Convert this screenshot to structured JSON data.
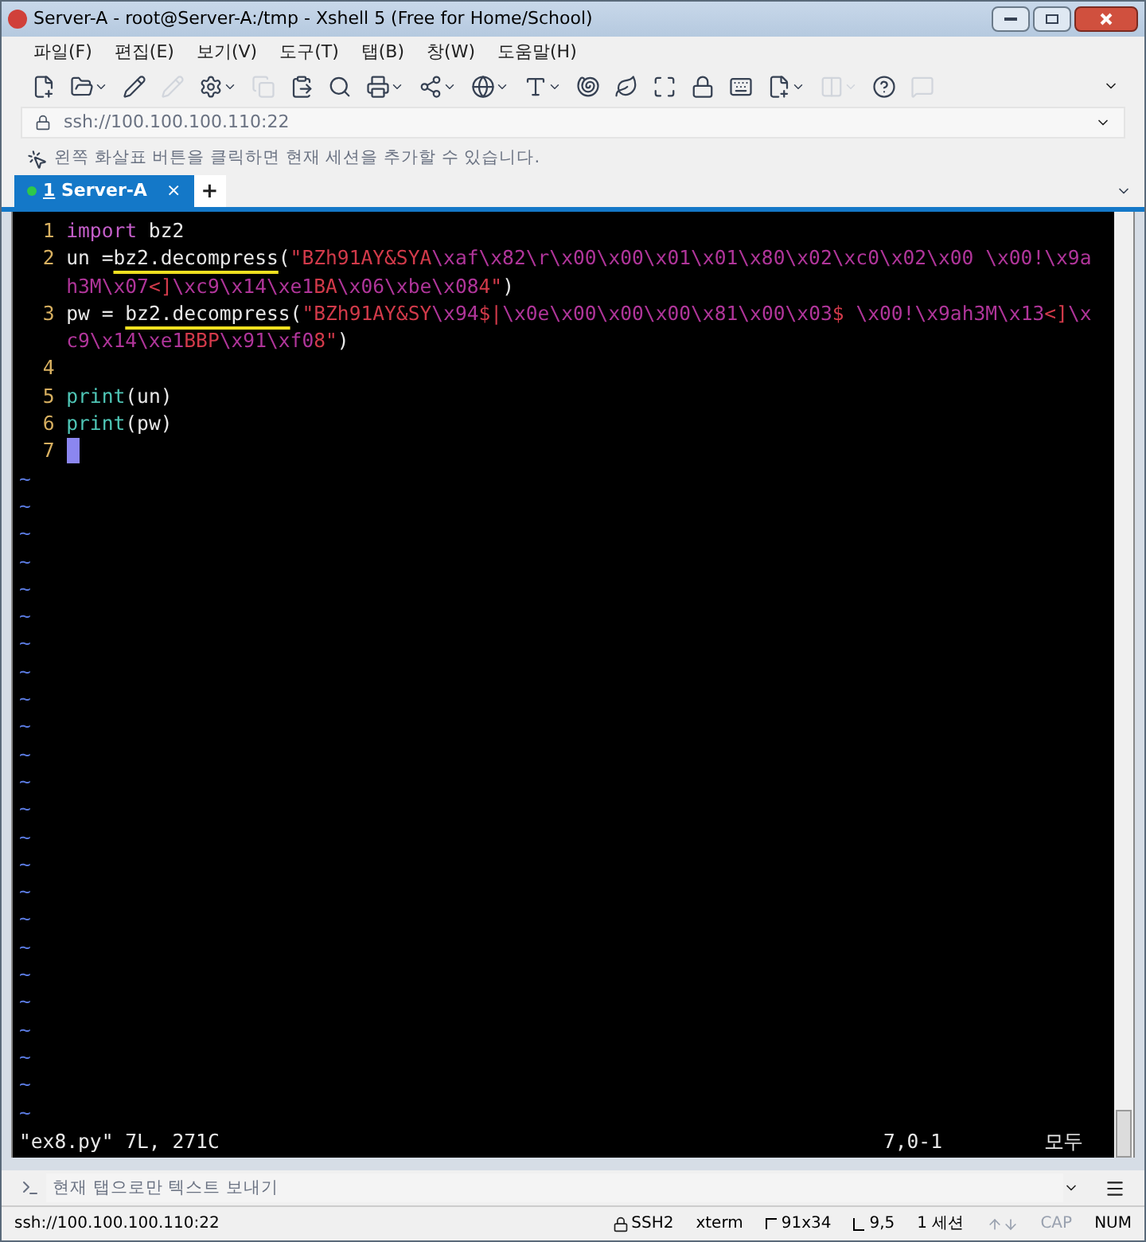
{
  "window": {
    "title": "Server-A - root@Server-A:/tmp - Xshell 5 (Free for Home/School)"
  },
  "menu": [
    "파일(F)",
    "편집(E)",
    "보기(V)",
    "도구(T)",
    "탭(B)",
    "창(W)",
    "도움말(H)"
  ],
  "address": {
    "value": "ssh://100.100.100.110:22"
  },
  "hint": "왼쪽 화살표 버튼을 클릭하면 현재 세션을 추가할 수 있습니다.",
  "tabs": [
    {
      "number": "1",
      "label": "Server-A",
      "selected": true,
      "close": "×"
    }
  ],
  "new_tab": "+",
  "editor": {
    "lines": [
      {
        "number": "1",
        "tokens": [
          {
            "kind": "kw",
            "text": "import"
          },
          {
            "kind": "plain",
            "text": " bz2"
          }
        ]
      },
      {
        "number": "2",
        "tokens": [
          {
            "kind": "plain",
            "text": "un ="
          },
          {
            "kind": "func",
            "text": "bz2.decompress"
          },
          {
            "kind": "plain",
            "text": "("
          },
          {
            "kind": "str",
            "text": "\"BZh91AY&SYA"
          },
          {
            "kind": "esc",
            "text": "\\xaf\\x82\\r\\x00\\x00\\x01\\x01\\x80\\x02\\xc0\\x02\\x00 \\x00!\\x9ah3M\\x07"
          },
          {
            "kind": "str",
            "text": "<]"
          },
          {
            "kind": "esc",
            "text": "\\xc9\\x14\\xe1"
          },
          {
            "kind": "str",
            "text": "BA"
          },
          {
            "kind": "esc",
            "text": "\\x06\\xbe\\x08"
          },
          {
            "kind": "str",
            "text": "4\""
          },
          {
            "kind": "plain",
            "text": ")"
          }
        ]
      },
      {
        "number": "3",
        "tokens": [
          {
            "kind": "plain",
            "text": "pw = "
          },
          {
            "kind": "func",
            "text": "bz2.decompress"
          },
          {
            "kind": "plain",
            "text": "("
          },
          {
            "kind": "str",
            "text": "\"BZh91AY&SY"
          },
          {
            "kind": "esc",
            "text": "\\x94"
          },
          {
            "kind": "str",
            "text": "$|"
          },
          {
            "kind": "esc",
            "text": "\\x0e\\x00\\x00\\x00\\x81\\x00\\x03"
          },
          {
            "kind": "str",
            "text": "$ "
          },
          {
            "kind": "esc",
            "text": "\\x00!\\x9ah3M\\x13"
          },
          {
            "kind": "str",
            "text": "<]"
          },
          {
            "kind": "esc",
            "text": "\\xc9\\x14\\xe1"
          },
          {
            "kind": "str",
            "text": "BBP"
          },
          {
            "kind": "esc",
            "text": "\\x91\\xf0"
          },
          {
            "kind": "str",
            "text": "8\""
          },
          {
            "kind": "plain",
            "text": ")"
          }
        ]
      },
      {
        "number": "4"
      },
      {
        "number": "5",
        "tokens": [
          {
            "kind": "builtin",
            "text": "print"
          },
          {
            "kind": "plain",
            "text": "(un)"
          }
        ]
      },
      {
        "number": "6",
        "tokens": [
          {
            "kind": "builtin",
            "text": "print"
          },
          {
            "kind": "plain",
            "text": "(pw)"
          }
        ]
      },
      {
        "number": "7",
        "tokens": [
          {
            "kind": "cursor"
          }
        ]
      }
    ],
    "tildes": [
      "~",
      "~",
      "~",
      "~",
      "~",
      "~",
      "~",
      "~",
      "~",
      "~",
      "~",
      "~",
      "~",
      "~",
      "~",
      "~",
      "~",
      "~",
      "~",
      "~",
      "~",
      "~",
      "~",
      "~"
    ],
    "status_left": "\"ex8.py\" 7L, 271C",
    "position": "7,0-1",
    "scroll": "모두"
  },
  "send_bar": {
    "placeholder": "현재 탭으로만 텍스트 보내기"
  },
  "status_bar": [
    {
      "kind": "address",
      "text": "ssh://100.100.100.110:22",
      "on": true
    },
    {
      "kind": "lock",
      "text": "SSH2",
      "on": true
    },
    {
      "kind": "text",
      "text": "xterm",
      "on": true
    },
    {
      "kind": "size",
      "text": "91x34",
      "on": true
    },
    {
      "kind": "cursor",
      "text": "9,5",
      "on": true
    },
    {
      "kind": "sessions",
      "text": "1 세션",
      "on": true
    },
    {
      "kind": "text",
      "text": "CAP",
      "on": false
    },
    {
      "kind": "text",
      "text": "NUM",
      "on": true
    }
  ]
}
